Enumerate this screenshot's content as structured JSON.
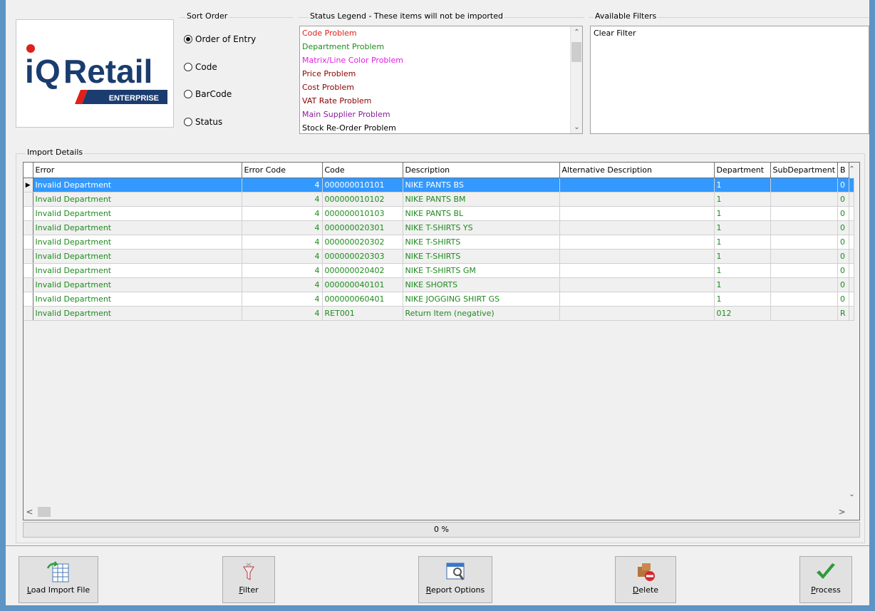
{
  "logo": {
    "brand_i": "i",
    "brand_q": "Q",
    "brand_rest": "Retail",
    "edition": "ENTERPRISE"
  },
  "sort_order": {
    "title": "Sort Order",
    "options": [
      {
        "label": "Order of Entry",
        "selected": true
      },
      {
        "label": "Code",
        "selected": false
      },
      {
        "label": "BarCode",
        "selected": false
      },
      {
        "label": "Status",
        "selected": false
      }
    ]
  },
  "status_legend": {
    "title": "Status Legend - These items will not be imported",
    "items": [
      {
        "label": "Code Problem",
        "color": "#e0201a"
      },
      {
        "label": "Department Problem",
        "color": "#1e8a1e"
      },
      {
        "label": "Matrix/Line Color Problem",
        "color": "#e020e0"
      },
      {
        "label": "Price Problem",
        "color": "#8b0000"
      },
      {
        "label": "Cost Problem",
        "color": "#8b0000"
      },
      {
        "label": "VAT Rate Problem",
        "color": "#8b0000"
      },
      {
        "label": "Main Supplier Problem",
        "color": "#8a1a9a"
      },
      {
        "label": "Stock Re-Order Problem",
        "color": "#000000"
      }
    ]
  },
  "available_filters": {
    "title": "Available Filters",
    "items": [
      "Clear Filter"
    ]
  },
  "import_details": {
    "title": "Import Details",
    "columns": [
      "Error",
      "Error Code",
      "Code",
      "Description",
      "Alternative Description",
      "Department",
      "SubDepartment",
      "B"
    ],
    "rows": [
      [
        "Invalid Department",
        "4",
        "000000010101",
        "NIKE PANTS BS",
        "",
        "1",
        "",
        "0"
      ],
      [
        "Invalid Department",
        "4",
        "000000010102",
        "NIKE PANTS BM",
        "",
        "1",
        "",
        "0"
      ],
      [
        "Invalid Department",
        "4",
        "000000010103",
        "NIKE PANTS BL",
        "",
        "1",
        "",
        "0"
      ],
      [
        "Invalid Department",
        "4",
        "000000020301",
        "NIKE T-SHIRTS YS",
        "",
        "1",
        "",
        "0"
      ],
      [
        "Invalid Department",
        "4",
        "000000020302",
        "NIKE T-SHIRTS",
        "",
        "1",
        "",
        "0"
      ],
      [
        "Invalid Department",
        "4",
        "000000020303",
        "NIKE T-SHIRTS",
        "",
        "1",
        "",
        "0"
      ],
      [
        "Invalid Department",
        "4",
        "000000020402",
        "NIKE T-SHIRTS GM",
        "",
        "1",
        "",
        "0"
      ],
      [
        "Invalid Department",
        "4",
        "000000040101",
        "NIKE SHORTS",
        "",
        "1",
        "",
        "0"
      ],
      [
        "Invalid Department",
        "4",
        "000000060401",
        "NIKE JOGGING SHIRT GS",
        "",
        "1",
        "",
        "0"
      ],
      [
        "Invalid Department",
        "4",
        "RET001",
        "Return Item (negative)",
        "",
        "012",
        "",
        "R"
      ]
    ],
    "selected_row": 0,
    "progress": "0 %"
  },
  "toolbar": {
    "load_key": "L",
    "load_rest": "oad Import File",
    "filter_key": "F",
    "filter_rest": "ilter",
    "report_key": "R",
    "report_rest": "eport Options",
    "delete_key": "D",
    "delete_rest": "elete",
    "process_key": "P",
    "process_rest": "rocess"
  }
}
